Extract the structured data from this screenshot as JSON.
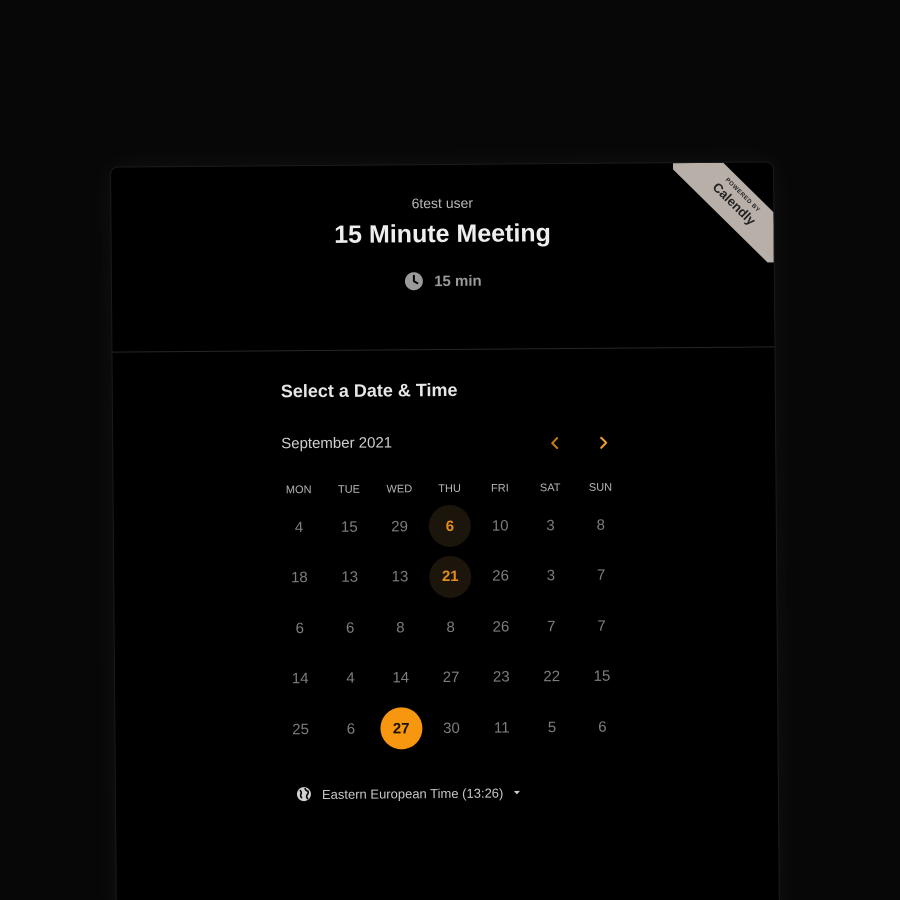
{
  "header": {
    "owner_name": "6test user",
    "event_title": "15 Minute Meeting",
    "duration_label": "15 min",
    "duration_icon": "clock-icon"
  },
  "badge": {
    "powered_by": "POWERED BY",
    "brand": "Calendly"
  },
  "picker": {
    "section_title": "Select a Date & Time",
    "month_label": "September 2021",
    "prev_icon": "chevron-left-icon",
    "next_icon": "chevron-right-icon",
    "weekdays": [
      "MON",
      "TUE",
      "WED",
      "THU",
      "FRI",
      "SAT",
      "SUN"
    ],
    "weeks": [
      [
        "4",
        "15",
        "29",
        "6",
        "10",
        "3",
        "8"
      ],
      [
        "18",
        "13",
        "13",
        "21",
        "26",
        "3",
        "7"
      ],
      [
        "6",
        "6",
        "8",
        "8",
        "26",
        "7",
        "7"
      ],
      [
        "14",
        "4",
        "14",
        "27",
        "23",
        "22",
        "15"
      ],
      [
        "25",
        "6",
        "27",
        "30",
        "11",
        "5",
        "6"
      ]
    ],
    "available_days": [
      "6",
      "21"
    ],
    "selected_day": "27"
  },
  "timezone": {
    "label": "Eastern European Time (13:26)",
    "icon": "globe-icon"
  },
  "colors": {
    "accent": "#f7970f",
    "accent_text": "#e38d1a",
    "available_bg": "#1b150c",
    "background": "#000000"
  }
}
